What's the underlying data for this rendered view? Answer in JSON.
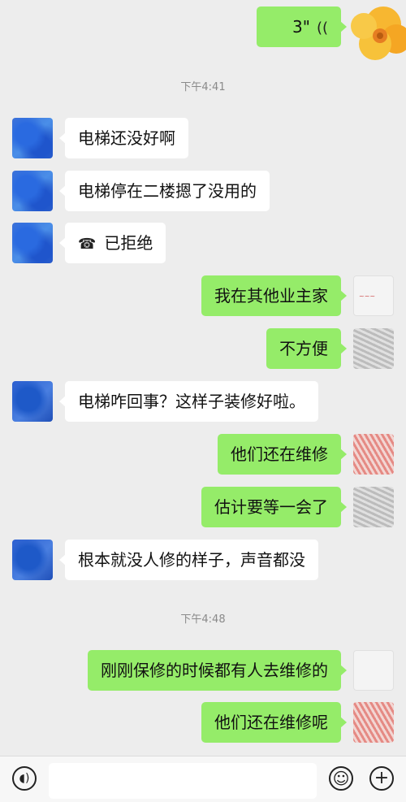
{
  "messages": {
    "m0": {
      "text": "3\""
    },
    "ts1": "下午4:41",
    "m1": "电梯还没好啊",
    "m2": "电梯停在二楼摁了没用的",
    "m3": "已拒绝",
    "m4": "我在其他业主家",
    "m5": "不方便",
    "m6": "电梯咋回事？这样子装修好啦。",
    "m7": "他们还在维修",
    "m8": "估计要等一会了",
    "m9": "根本就没人修的样子，声音都没",
    "ts2": "下午4:48",
    "m10": "刚刚保修的时候都有人去维修的",
    "m11": "他们还在维修呢"
  },
  "colors": {
    "background": "#ededed",
    "outgoing_bubble": "#95ec69",
    "incoming_bubble": "#ffffff"
  }
}
